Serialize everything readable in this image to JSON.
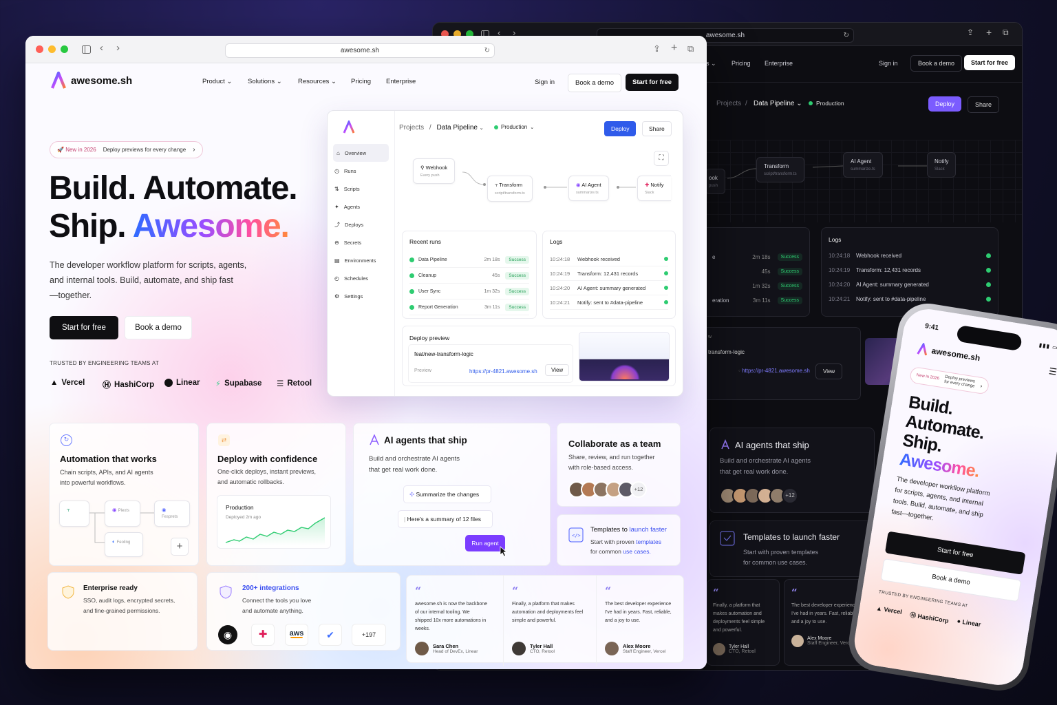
{
  "browser": {
    "url": "awesome.sh"
  },
  "brand": {
    "name": "awesome.sh"
  },
  "nav": {
    "items": [
      "Product",
      "Solutions",
      "Resources",
      "Pricing",
      "Enterprise"
    ],
    "dark_items": [
      "Pricing",
      "Enterprise"
    ],
    "sign_in": "Sign in",
    "book_demo": "Book a demo",
    "start_free": "Start for free"
  },
  "announcement": {
    "badge": "New in 2026",
    "text": "Deploy previews for every change"
  },
  "hero": {
    "line1": "Build. Automate.",
    "line2a": "Ship. ",
    "line2b": "Awesome.",
    "body1": "The developer workflow platform for scripts, agents,",
    "body2": "and internal tools. Build, automate, and ship fast",
    "body3": "—together.",
    "cta_primary": "Start for free",
    "cta_secondary": "Book a demo"
  },
  "trusted": {
    "label": "TRUSTED BY ENGINEERING TEAMS AT",
    "logos": [
      "Vercel",
      "HashiCorp",
      "Linear",
      "Supabase",
      "Retool"
    ]
  },
  "app": {
    "breadcrumb_root": "Projects",
    "breadcrumb_sep": "/",
    "project": "Data Pipeline",
    "environment": "Production",
    "deploy": "Deploy",
    "share": "Share",
    "sidebar": [
      "Overview",
      "Runs",
      "Scripts",
      "Agents",
      "Deploys",
      "Secrets",
      "Environments",
      "Schedules",
      "Settings"
    ],
    "flow": [
      {
        "name": "Webhook",
        "sub": "Every push"
      },
      {
        "name": "Transform",
        "sub": "script/transform.ts"
      },
      {
        "name": "AI Agent",
        "sub": "summarize.ts"
      },
      {
        "name": "Notify",
        "sub": "Slack"
      }
    ],
    "recent_runs_title": "Recent runs",
    "runs": [
      {
        "name": "Data Pipeline",
        "time": "2m 18s",
        "status": "Success"
      },
      {
        "name": "Cleanup",
        "time": "45s",
        "status": "Success"
      },
      {
        "name": "User Sync",
        "time": "1m 32s",
        "status": "Success"
      },
      {
        "name": "Report Generation",
        "time": "3m 11s",
        "status": "Success"
      }
    ],
    "logs_title": "Logs",
    "logs": [
      {
        "time": "10:24:18",
        "msg": "Webhook received"
      },
      {
        "time": "10:24:19",
        "msg": "Transform: 12,431 records"
      },
      {
        "time": "10:24:20",
        "msg": "AI Agent: summary generated"
      },
      {
        "time": "10:24:21",
        "msg": "Notify: sent to #data-pipeline"
      }
    ],
    "deploy_preview_title": "Deploy preview",
    "branch": "feat/new-transform-logic",
    "preview_label": "Preview",
    "preview_url": "https://pr-4821.awesome.sh",
    "view": "View"
  },
  "features": {
    "automation": {
      "title": "Automation that works",
      "line1": "Chain scripts, APIs, and AI agents",
      "line2": "into powerful workflows.",
      "nodes": [
        "Plexts",
        "Fesprets",
        "Feoling"
      ]
    },
    "deploy": {
      "title": "Deploy with confidence",
      "line1": "One-click deploys, instant previews,",
      "line2": "and automatic rollbacks.",
      "env": "Production",
      "env_sub": "Deployed 2m ago"
    },
    "agents": {
      "title": "AI agents that ship",
      "line1": "Build and orchestrate AI agents",
      "line2": "that get real work done.",
      "prompt": "Summarize the changes",
      "reply": "Here's a summary of 12 files",
      "button": "Run agent"
    },
    "collab": {
      "title": "Collaborate as a team",
      "line1": "Share, review, and run together",
      "line2": "with role-based access.",
      "more": "+12"
    },
    "templates": {
      "title_a": "Templates to ",
      "title_b": "launch faster",
      "line1a": "Start with proven ",
      "line1b": "templates",
      "line2a": "for common ",
      "line2b": "use cases.",
      "dark_title": "Templates to launch faster",
      "dark_line1": "Start with proven templates",
      "dark_line2": "for common use cases."
    },
    "enterprise": {
      "title": "Enterprise ready",
      "line1": "SSO, audit logs, encrypted secrets,",
      "line2": "and fine-grained permissions."
    },
    "integrations": {
      "title": "200+ integrations",
      "line1": "Connect the tools you love",
      "line2": "and automate anything.",
      "more": "+197",
      "aws": "aws"
    }
  },
  "testimonials": [
    {
      "text": "awesome.sh is now the backbone of our internal tooling. We shipped 10x more automations in weeks.",
      "name": "Sara Chen",
      "role": "Head of DevEx, Linear"
    },
    {
      "text": "Finally, a platform that makes automation and deployments feel simple and powerful.",
      "name": "Tyler Hall",
      "role": "CTO, Retool"
    },
    {
      "text": "The best developer experience I've had in years. Fast, reliable, and a joy to use.",
      "name": "Alex Moore",
      "role": "Staff Engineer, Vercel"
    }
  ],
  "dark": {
    "partial_nav": "es",
    "partial_node": "ook",
    "partial_node_sub": "push",
    "partial_run": "e",
    "partial_run4": "eration",
    "partial_w": "w",
    "partial_branch": "transform-logic"
  },
  "phone": {
    "time": "9:41",
    "brand": "awesome.sh",
    "badge": "New in 2026",
    "badge_text1": "Deploy previews",
    "badge_text2": "for every change",
    "h1": "Build.",
    "h2": "Automate.",
    "h3": "Ship.",
    "h4": "Awesome.",
    "b1": "The developer workflow platform",
    "b2": "for scripts, agents, and internal",
    "b3": "tools. Build, automate, and ship",
    "b4": "fast—together.",
    "cta": "Start for free",
    "cta2": "Book a demo",
    "trusted": "TRUSTED BY ENGINEERING TEAMS AT",
    "logos": [
      "Vercel",
      "HashiCorp",
      "Linear"
    ]
  },
  "colors": {
    "accent": "#2f5bea",
    "purple": "#7b4dff",
    "success": "#2ecc71",
    "dark_deploy": "#7b5cff"
  }
}
